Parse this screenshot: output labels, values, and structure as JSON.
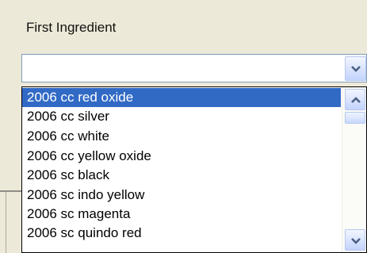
{
  "field": {
    "label": "First Ingredient",
    "value": ""
  },
  "dropdown": {
    "selected_index": 0,
    "items": [
      "2006 cc red oxide",
      "2006 cc silver",
      "2006 cc white",
      "2006 cc yellow oxide",
      "2006 sc black",
      "2006 sc indo yellow",
      "2006 sc magenta",
      "2006 sc quindo red"
    ]
  },
  "icons": {
    "combo_arrow": "chevron-down-icon",
    "scroll_up": "chevron-up-icon",
    "scroll_down": "chevron-down-icon"
  },
  "colors": {
    "selection": "#316ac5",
    "window_background": "#ece9d8",
    "chevron": "#4d6185"
  }
}
